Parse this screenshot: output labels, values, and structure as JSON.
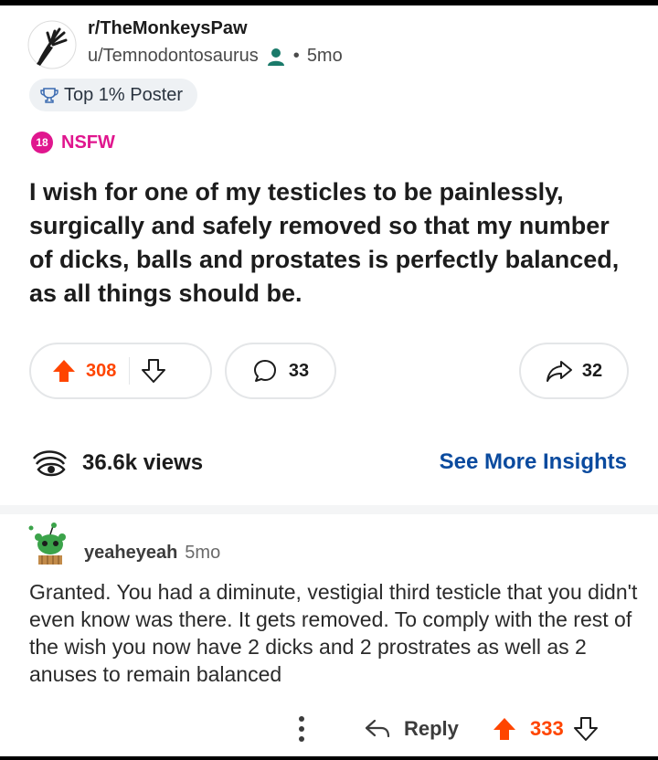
{
  "post": {
    "subreddit": "r/TheMonkeysPaw",
    "author": "u/Temnodontosaurus",
    "separator": "•",
    "age": "5mo",
    "flair": "Top 1% Poster",
    "nsfw_badge": "18",
    "nsfw_label": "NSFW",
    "title": "I wish for one of my testicles to be painlessly, surgically and safely removed so that my number of dicks, balls and prostates is perfectly balanced, as all things should be.",
    "upvotes": "308",
    "comments": "33",
    "shares": "32",
    "views": "36.6k views",
    "insights_link": "See More Insights"
  },
  "comment": {
    "author": "yeaheyeah",
    "age": "5mo",
    "body": "Granted. You had a diminute, vestigial third testicle that you didn't even know was there. It gets removed. To comply with the rest of the wish you now have 2 dicks and 2 prostrates as well as 2 anuses to remain balanced",
    "reply_label": "Reply",
    "upvotes": "333"
  },
  "icons": {
    "subreddit_avatar": "monkey-paw-icon",
    "person": "person-icon",
    "flair": "trophy-icon",
    "upvote": "upvote-arrow-icon",
    "downvote": "downvote-arrow-icon",
    "comment": "comment-bubble-icon",
    "share": "share-arrow-icon",
    "views": "eye-icon",
    "more": "more-options-icon",
    "reply": "reply-arrow-icon",
    "comment_avatar": "snoo-avatar-icon"
  },
  "colors": {
    "upvote_orange": "#ff4500",
    "nsfw_pink": "#e0168e",
    "link_blue": "#0a4a9e",
    "person_teal": "#1a7a6a"
  }
}
